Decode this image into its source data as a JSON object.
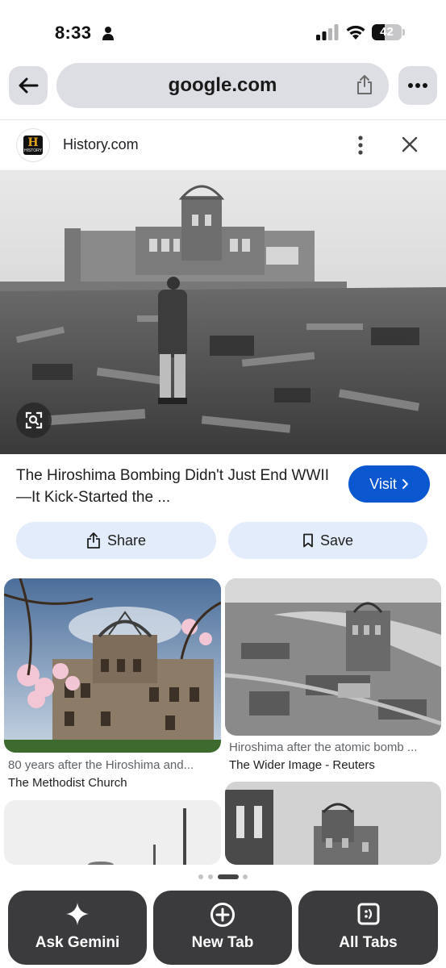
{
  "status_bar": {
    "time": "8:33",
    "battery": "42",
    "battery_level": 0.42
  },
  "toolbar": {
    "url": "google.com"
  },
  "source": {
    "logo_text": "H",
    "logo_subtext": "HISTORY",
    "name": "History.com"
  },
  "result": {
    "title": "The Hiroshima Bombing Didn't Just End WWII—It Kick-Started the ...",
    "visit_label": "Visit",
    "share_label": "Share",
    "save_label": "Save"
  },
  "related": [
    {
      "caption": "80 years after the Hiroshima and...",
      "source": "The Methodist Church"
    },
    {
      "caption": "Hiroshima after the atomic bomb ...",
      "source": "The Wider Image - Reuters"
    }
  ],
  "bottom_bar": {
    "ask_gemini": "Ask Gemini",
    "new_tab": "New Tab",
    "all_tabs": "All Tabs"
  },
  "colors": {
    "accent": "#0b57d0",
    "pill": "#e3ecfb",
    "bottom_bar": "#2d2d2f"
  },
  "icons": [
    "person-icon",
    "signal-icon",
    "wifi-icon",
    "back-arrow-icon",
    "share-icon",
    "more-icon",
    "kebab-icon",
    "close-icon",
    "lens-icon",
    "chevron-right-icon",
    "bookmark-icon",
    "gemini-sparkle-icon",
    "plus-circle-icon",
    "tabs-icon"
  ]
}
